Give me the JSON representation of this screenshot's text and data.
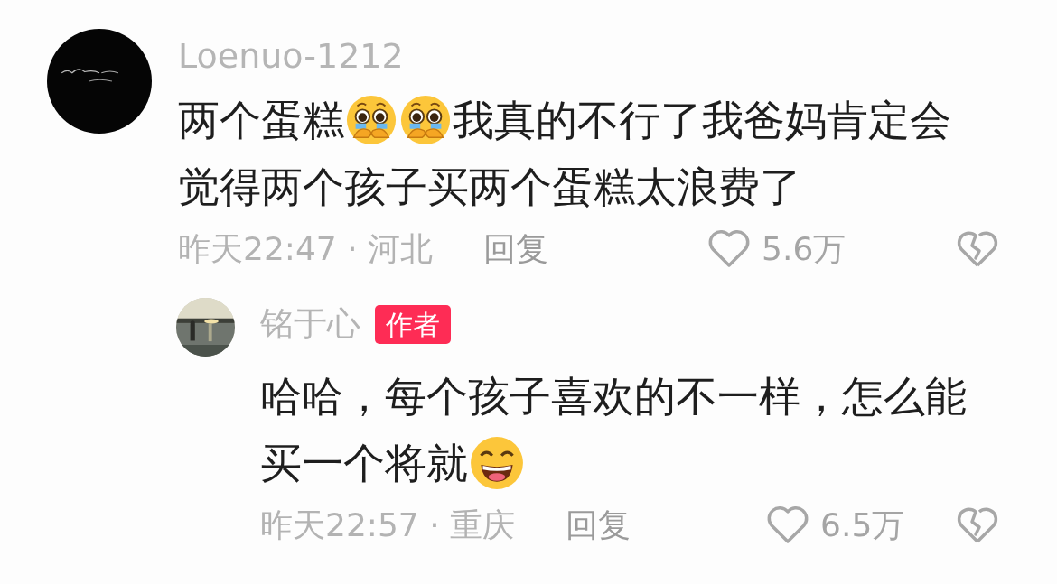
{
  "comments": [
    {
      "username": "Loenuo-1212",
      "avatar": {
        "kind": "picture"
      },
      "lines": [
        [
          {
            "kind": "text",
            "text": "两个蛋糕"
          },
          {
            "kind": "crying-emoji"
          },
          {
            "kind": "crying-emoji"
          },
          {
            "kind": "text",
            "text": "我真的不行了我爸妈肯定会"
          }
        ],
        [
          {
            "kind": "text",
            "text": "觉得两个孩子买两个蛋糕太浪费了"
          }
        ]
      ],
      "time": "昨天22:47 · 河北",
      "reply": "回复",
      "likes": "5.6万",
      "replies": [
        {
          "username": "铭于心",
          "badge": "作者",
          "avatar": {
            "kind": "picture"
          },
          "lines": [
            [
              {
                "kind": "text",
                "text": "哈哈，每个孩子喜欢的不一样，怎么能"
              }
            ],
            [
              {
                "kind": "text",
                "text": "买一个将就"
              },
              {
                "kind": "grin-emoji"
              }
            ]
          ],
          "time": "昨天22:57 · 重庆",
          "reply": "回复",
          "likes": "6.5万"
        }
      ]
    }
  ]
}
